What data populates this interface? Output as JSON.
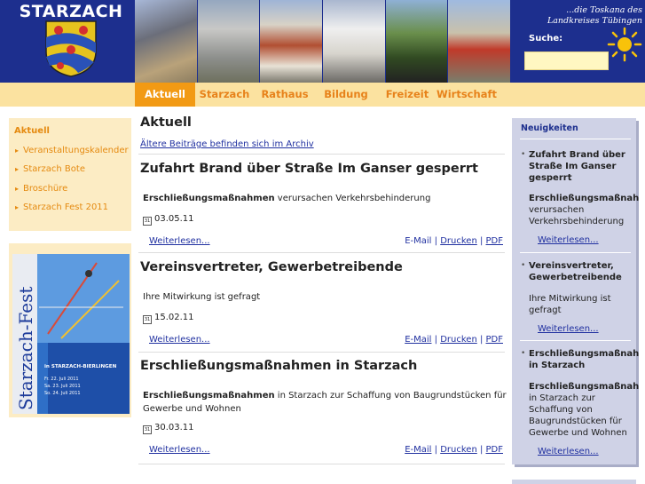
{
  "header": {
    "site_name": "STARZACH",
    "tagline": "...die Toskana des Landkreises Tübingen",
    "search_label": "Suche:",
    "search_value": "",
    "colors": {
      "bar": "#1d2f8e",
      "accent": "#f29a14"
    }
  },
  "nav": {
    "items": [
      {
        "label": "Aktuell",
        "active": true
      },
      {
        "label": "Starzach",
        "active": false
      },
      {
        "label": "Rathaus",
        "active": false
      },
      {
        "label": "Bildung",
        "active": false
      },
      {
        "label": "Freizeit",
        "active": false
      },
      {
        "label": "Wirtschaft",
        "active": false
      }
    ]
  },
  "sidebar": {
    "heading": "Aktuell",
    "items": [
      "Veranstaltungskalender",
      "Starzach Bote",
      "Broschüre",
      "Starzach Fest 2011"
    ],
    "promo": {
      "vertical_title": "Starzach-Fest",
      "place": "in STARZACH-BIERLINGEN",
      "dates": [
        "Fr. 22. Juli 2011",
        "Sa. 23. Juli 2011",
        "So. 24. Juli 2011"
      ]
    }
  },
  "main": {
    "heading": "Aktuell",
    "archive_link": "Ältere Beiträge befinden sich im Archiv",
    "articles": [
      {
        "title": "Zufahrt Brand über Straße Im Ganser gesperrt",
        "lead_bold": "Erschließungsmaßnahmen",
        "lead_rest": " verursachen Verkehrsbehinderung",
        "date": "03.05.11",
        "more": "Weiterlesen...",
        "email": "E-Mail",
        "print": "Drucken",
        "pdf": "PDF"
      },
      {
        "title": "Vereinsvertreter, Gewerbetreibende",
        "lead_bold": "",
        "lead_rest": "Ihre Mitwirkung ist gefragt",
        "date": "15.02.11",
        "more": "Weiterlesen...",
        "email": "E-Mail",
        "print": "Drucken",
        "pdf": "PDF"
      },
      {
        "title": "Erschließungsmaßnahmen in Starzach",
        "lead_bold": "Erschließungsmaßnahmen",
        "lead_rest": " in Starzach zur Schaffung von Baugrundstücken für",
        "lead_line2": "Gewerbe und Wohnen",
        "date": "30.03.11",
        "more": "Weiterlesen...",
        "email": "E-Mail",
        "print": "Drucken",
        "pdf": "PDF"
      }
    ]
  },
  "news": {
    "heading": "Neuigkeiten",
    "items": [
      {
        "title_lines": [
          "Zufahrt Brand über",
          "Straße Im Ganser",
          "gesperrt"
        ],
        "bold_lead": "Erschließungsmaßnah",
        "text_lines": [
          "verursachen",
          "Verkehrsbehinderung"
        ],
        "more": "Weiterlesen..."
      },
      {
        "title_lines": [
          "Vereinsvertreter,",
          "Gewerbetreibende"
        ],
        "text_lines": [
          "Ihre Mitwirkung ist",
          "gefragt"
        ],
        "more": "Weiterlesen..."
      },
      {
        "title_lines": [
          "Erschließungsmaßnah",
          "in Starzach"
        ],
        "bold_lead": "Erschließungsmaßnah",
        "text_lines": [
          "in Starzach zur",
          "Schaffung von",
          "Baugrundstücken für",
          "Gewerbe und Wohnen"
        ],
        "more": "Weiterlesen..."
      }
    ]
  },
  "icons": [
    "crest-logo",
    "calendar-icon",
    "sun-icon",
    "arrow-bullet-icon"
  ]
}
